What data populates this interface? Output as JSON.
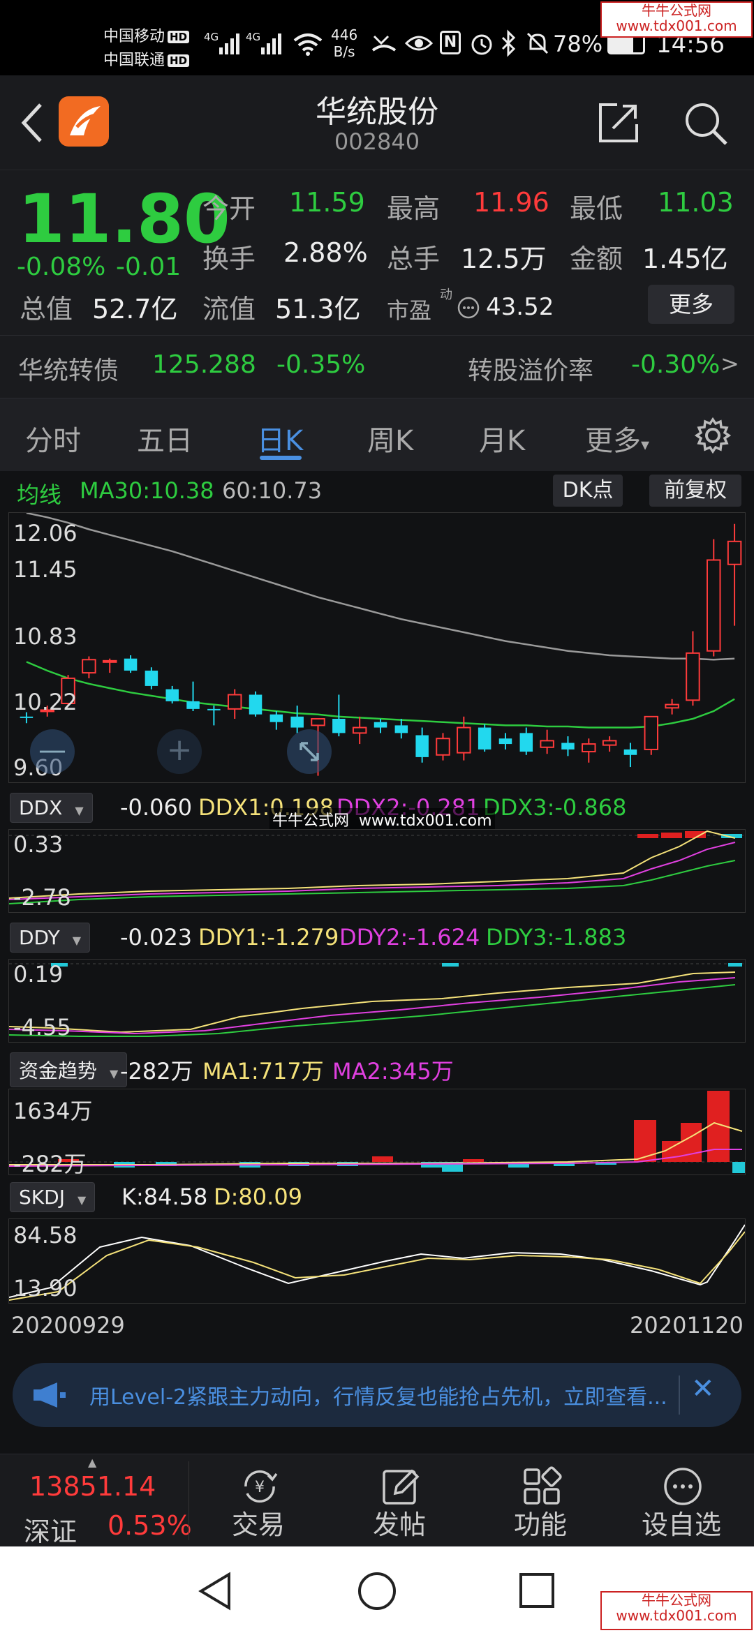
{
  "status": {
    "carrier1": "中国移动",
    "carrier2": "中国联通",
    "hd": "HD",
    "net": "4G",
    "speed": "446",
    "speed_unit": "B/s",
    "nfc": "N",
    "battery": "78%",
    "time": "14:56"
  },
  "watermark": {
    "top": "牛牛公式网",
    "url": "www.tdx001.com"
  },
  "header": {
    "name": "华统股份",
    "code": "002840"
  },
  "quote": {
    "price": "11.80",
    "change_pct": "-0.08%",
    "change": "-0.01",
    "fields": [
      {
        "label": "今开",
        "value": "11.59"
      },
      {
        "label": "最高",
        "value": "11.96"
      },
      {
        "label": "最低",
        "value": "11.03"
      },
      {
        "label": "换手",
        "value": "2.88%"
      },
      {
        "label": "总手",
        "value": "12.5万"
      },
      {
        "label": "金额",
        "value": "1.45亿"
      },
      {
        "label": "总值",
        "value": "52.7亿"
      },
      {
        "label": "流值",
        "value": "51.3亿"
      },
      {
        "label": "市盈",
        "value": "43.52"
      }
    ],
    "pe_sup": "动",
    "more": "更多",
    "bond_name": "华统转债",
    "bond_price": "125.288",
    "bond_pct": "-0.35%",
    "premium_label": "转股溢价率",
    "premium_value": "-0.30%",
    "premium_arrow": ">"
  },
  "tabs": [
    "分时",
    "五日",
    "日K",
    "周K",
    "月K",
    "更多"
  ],
  "tabs_more_arrow": "▾",
  "kline": {
    "ma_label": "均线",
    "ma30": "MA30:10.38",
    "ma60": "60:10.73",
    "dk_button": "DK点",
    "fq_button": "前复权",
    "yticks": [
      "12.06",
      "11.45",
      "10.83",
      "10.22",
      "9.60"
    ],
    "minus": "—",
    "plus": "+"
  },
  "chart_data": {
    "type": "candlestick",
    "ylim": [
      9.6,
      12.06
    ],
    "ohlc": [
      [
        10.2,
        10.24,
        10.14,
        10.19
      ],
      [
        10.25,
        10.3,
        10.2,
        10.26
      ],
      [
        10.32,
        10.58,
        10.3,
        10.55
      ],
      [
        10.6,
        10.75,
        10.55,
        10.72
      ],
      [
        10.7,
        10.73,
        10.6,
        10.71
      ],
      [
        10.73,
        10.76,
        10.6,
        10.62
      ],
      [
        10.62,
        10.65,
        10.45,
        10.48
      ],
      [
        10.45,
        10.48,
        10.32,
        10.34
      ],
      [
        10.34,
        10.52,
        10.25,
        10.27
      ],
      [
        10.27,
        10.3,
        10.12,
        10.26
      ],
      [
        10.27,
        10.45,
        10.18,
        10.4
      ],
      [
        10.4,
        10.43,
        10.2,
        10.22
      ],
      [
        10.22,
        10.25,
        10.08,
        10.15
      ],
      [
        10.2,
        10.3,
        10.05,
        10.1
      ],
      [
        10.12,
        10.15,
        9.66,
        10.18
      ],
      [
        10.18,
        10.4,
        10.02,
        10.05
      ],
      [
        10.05,
        10.2,
        9.95,
        10.1
      ],
      [
        10.15,
        10.18,
        10.05,
        10.1
      ],
      [
        10.12,
        10.18,
        10.0,
        10.05
      ],
      [
        10.03,
        10.1,
        9.78,
        9.83
      ],
      [
        9.85,
        10.05,
        9.8,
        10.0
      ],
      [
        9.87,
        10.2,
        9.8,
        10.1
      ],
      [
        10.1,
        10.13,
        9.88,
        9.9
      ],
      [
        10.0,
        10.05,
        9.9,
        9.95
      ],
      [
        10.05,
        10.1,
        9.85,
        9.88
      ],
      [
        9.92,
        10.08,
        9.86,
        9.98
      ],
      [
        9.96,
        10.02,
        9.84,
        9.9
      ],
      [
        9.88,
        10.0,
        9.78,
        9.95
      ],
      [
        9.94,
        10.02,
        9.88,
        9.98
      ],
      [
        9.9,
        9.96,
        9.74,
        9.85
      ],
      [
        9.9,
        10.15,
        9.85,
        10.2
      ],
      [
        10.28,
        10.36,
        10.22,
        10.31
      ],
      [
        10.35,
        10.98,
        10.3,
        10.78
      ],
      [
        10.8,
        11.82,
        10.75,
        11.63
      ],
      [
        11.59,
        11.96,
        11.03,
        11.8
      ]
    ],
    "ma30": [
      10.7,
      10.62,
      10.55,
      10.5,
      10.46,
      10.42,
      10.39,
      10.36,
      10.33,
      10.31,
      10.29,
      10.27,
      10.25,
      10.23,
      10.22,
      10.2,
      10.19,
      10.18,
      10.17,
      10.16,
      10.15,
      10.14,
      10.13,
      10.12,
      10.12,
      10.11,
      10.11,
      10.1,
      10.1,
      10.1,
      10.11,
      10.14,
      10.18,
      10.25,
      10.36
    ],
    "ma60": [
      12.06,
      12.02,
      11.97,
      11.91,
      11.86,
      11.81,
      11.76,
      11.71,
      11.65,
      11.59,
      11.53,
      11.47,
      11.41,
      11.35,
      11.29,
      11.24,
      11.19,
      11.14,
      11.09,
      11.05,
      11.01,
      10.97,
      10.93,
      10.89,
      10.86,
      10.83,
      10.8,
      10.78,
      10.76,
      10.75,
      10.74,
      10.73,
      10.73,
      10.72,
      10.73
    ]
  },
  "ddx": {
    "name": "DDX",
    "value": "-0.060",
    "ddx1": "DDX1:0.198",
    "ddx2": "DDX2:-0.281",
    "ddx3": "DDX3:-0.868",
    "yticks": [
      "0.33",
      "-2.78"
    ]
  },
  "ddy": {
    "name": "DDY",
    "value": "-0.023",
    "ddy1": "DDY1:-1.279",
    "ddy2": "DDY2:-1.624",
    "ddy3": "DDY3:-1.883",
    "yticks": [
      "0.19",
      "-4.55"
    ]
  },
  "zjqs": {
    "name": "资金趋势",
    "value": "-282万",
    "ma1": "MA1:717万",
    "ma2": "MA2:345万",
    "yticks": [
      "1634万",
      "-282万"
    ]
  },
  "skdj": {
    "name": "SKDJ",
    "k": "K:84.58",
    "d": "D:80.09",
    "yticks": [
      "84.58",
      "13.90"
    ]
  },
  "dates": {
    "start": "20200929",
    "end": "20201120"
  },
  "banner": {
    "text": "用Level-2紧跟主力动向，行情反复也能抢占先机，立即查看...",
    "close": "✕"
  },
  "bottom": {
    "index_value": "13851.14",
    "index_name": "深证",
    "index_pct": "0.53%",
    "items": [
      "交易",
      "发帖",
      "功能",
      "设自选"
    ]
  }
}
